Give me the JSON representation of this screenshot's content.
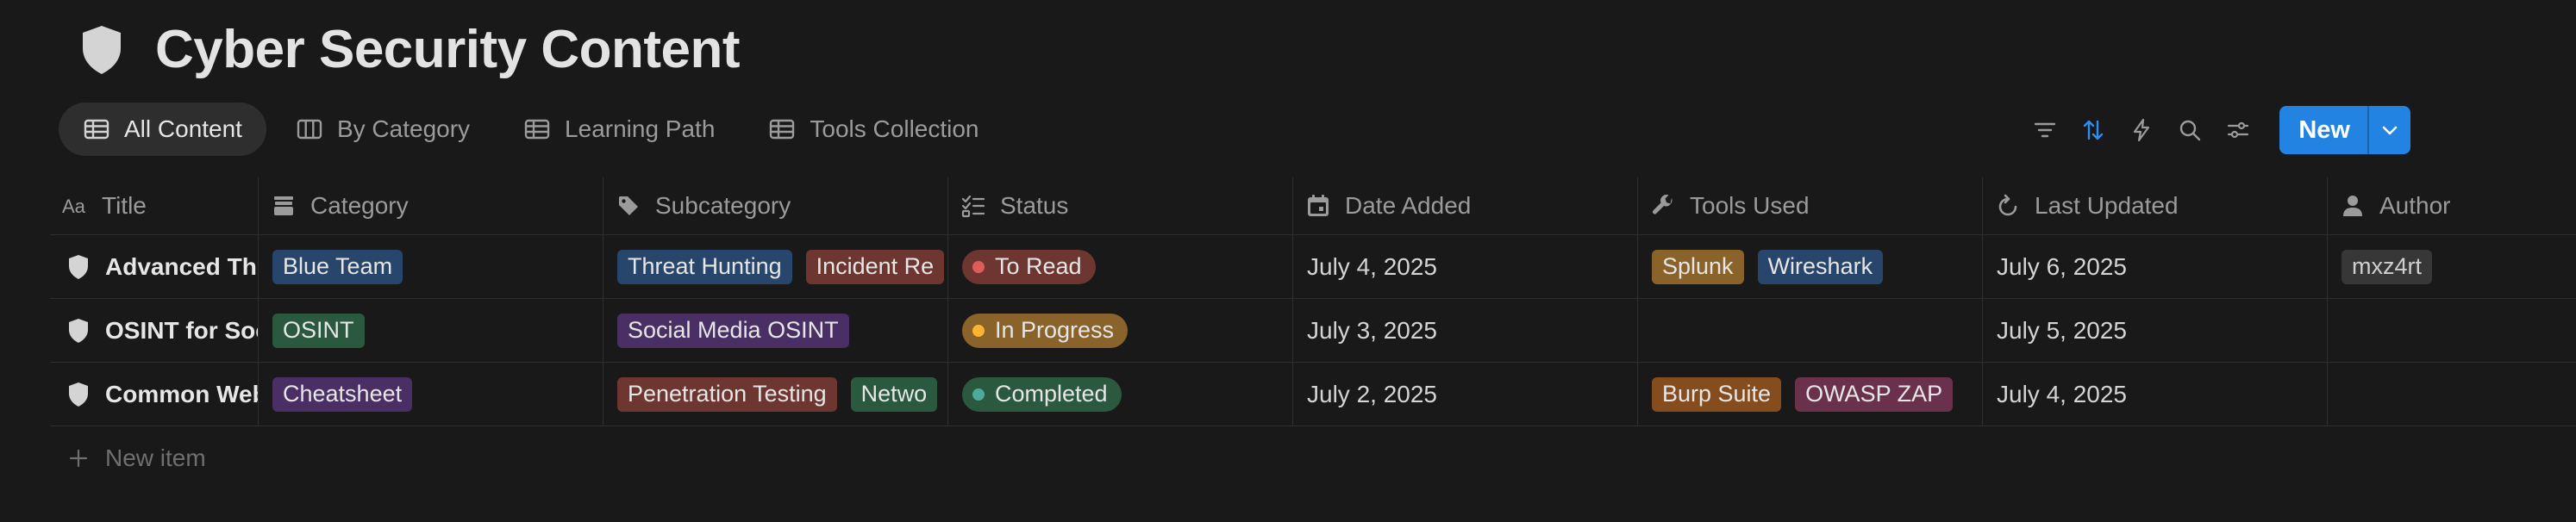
{
  "page": {
    "title": "Cyber Security Content",
    "icon": "shield-icon"
  },
  "tabs": [
    {
      "label": "All Content",
      "icon": "table-icon",
      "active": true
    },
    {
      "label": "By Category",
      "icon": "board-icon",
      "active": false
    },
    {
      "label": "Learning Path",
      "icon": "table-icon",
      "active": false
    },
    {
      "label": "Tools Collection",
      "icon": "table-icon",
      "active": false
    }
  ],
  "toolbar": {
    "icons": [
      "filter-icon",
      "sort-icon",
      "automation-bolt-icon",
      "search-icon",
      "settings-sliders-icon"
    ],
    "new_label": "New",
    "accent": "#2383e2"
  },
  "columns": [
    {
      "label": "Title",
      "icon": "text-aa-icon"
    },
    {
      "label": "Category",
      "icon": "select-archive-icon"
    },
    {
      "label": "Subcategory",
      "icon": "tag-icon"
    },
    {
      "label": "Status",
      "icon": "checklist-icon"
    },
    {
      "label": "Date Added",
      "icon": "calendar-icon"
    },
    {
      "label": "Tools Used",
      "icon": "wrench-icon"
    },
    {
      "label": "Last Updated",
      "icon": "refresh-icon"
    },
    {
      "label": "Author",
      "icon": "person-icon"
    }
  ],
  "rows": [
    {
      "title": "Advanced Thr",
      "category": {
        "label": "Blue Team",
        "color": "#28456c"
      },
      "subcategory": [
        {
          "label": "Threat Hunting",
          "color": "#28456c"
        },
        {
          "label": "Incident Re",
          "color": "#6e3630"
        }
      ],
      "status": {
        "label": "To Read",
        "color": "#6e3630"
      },
      "date_added": "July 4, 2025",
      "tools": [
        {
          "label": "Splunk",
          "color": "#89632a"
        },
        {
          "label": "Wireshark",
          "color": "#28456c"
        }
      ],
      "last_updated": "July 6, 2025",
      "author": "mxz4rt"
    },
    {
      "title": "OSINT for Soc",
      "category": {
        "label": "OSINT",
        "color": "#2b593f"
      },
      "subcategory": [
        {
          "label": "Social Media OSINT",
          "color": "#492f64"
        }
      ],
      "status": {
        "label": "In Progress",
        "color": "#89632a"
      },
      "date_added": "July 3, 2025",
      "tools": [],
      "last_updated": "July 5, 2025",
      "author": ""
    },
    {
      "title": "Common Web",
      "category": {
        "label": "Cheatsheet",
        "color": "#492f64"
      },
      "subcategory": [
        {
          "label": "Penetration Testing",
          "color": "#6e3630"
        },
        {
          "label": "Netwo",
          "color": "#2b593f"
        }
      ],
      "status": {
        "label": "Completed",
        "color": "#2b593f"
      },
      "date_added": "July 2, 2025",
      "tools": [
        {
          "label": "Burp Suite",
          "color": "#854c1d"
        },
        {
          "label": "OWASP ZAP",
          "color": "#69314c"
        }
      ],
      "last_updated": "July 4, 2025",
      "author": ""
    }
  ],
  "new_item_label": "New item"
}
